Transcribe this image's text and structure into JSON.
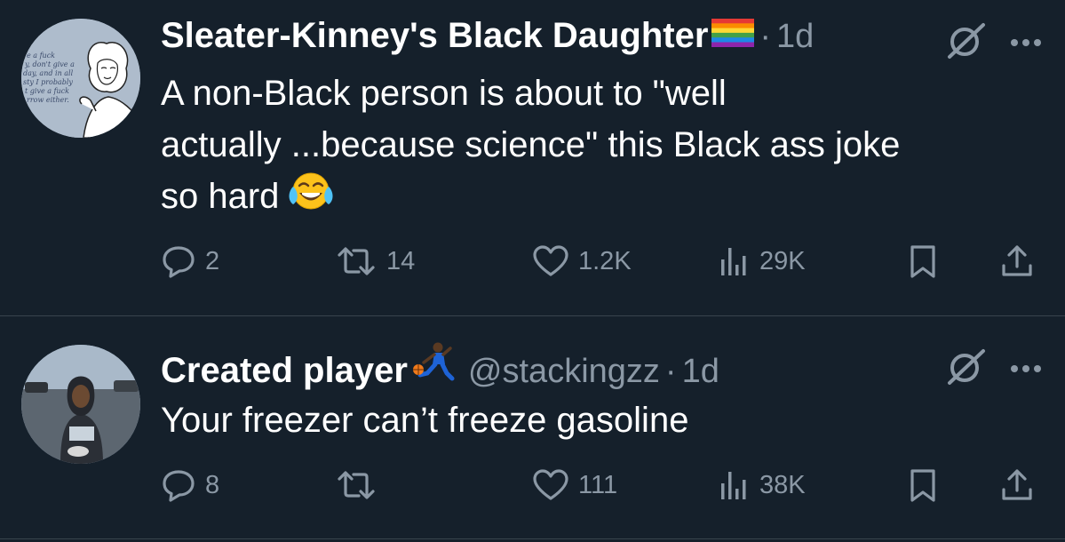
{
  "tweets": [
    {
      "display_name": "Sleater-Kinney's Black Daughter",
      "handle": "",
      "time": "1d",
      "text_lines": [
        "A non-Black person is about to \"well",
        "actually ...because science\" this Black ass joke",
        "so hard"
      ],
      "avatar_caption_lines": [
        "e a fuck",
        "y, don't give a",
        "day, and in all",
        "sty I probably",
        "t give a fuck",
        "rrow either."
      ],
      "badge_icon": "rainbow-flag-icon",
      "emoji_icon": "tears-of-joy-emoji",
      "reply_count": "2",
      "retweet_count": "14",
      "like_count": "1.2K",
      "view_count": "29K"
    },
    {
      "display_name": "Created player",
      "handle": "@stackingzz",
      "time": "1d",
      "text_lines": [
        "Your freezer can’t freeze gasoline"
      ],
      "badge_icon": "basketball-player-emoji",
      "reply_count": "8",
      "retweet_count": "",
      "like_count": "111",
      "view_count": "38K"
    }
  ],
  "colors": {
    "background": "#15202b",
    "primary_text": "#ffffff",
    "secondary_text": "#8b98a5",
    "divider": "#38444d"
  }
}
